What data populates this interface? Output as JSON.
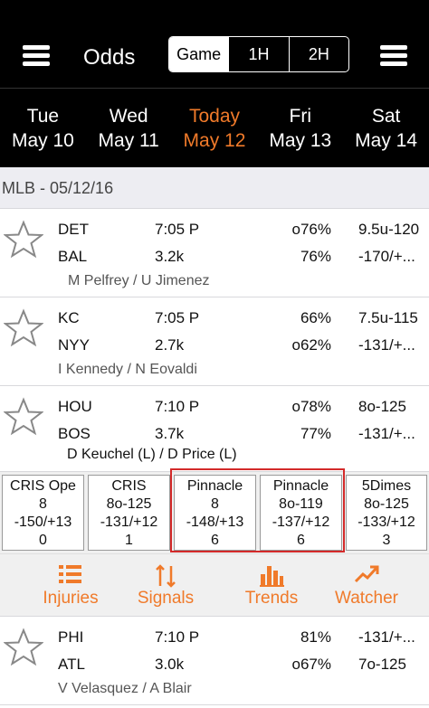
{
  "header": {
    "title": "Odds",
    "segments": [
      "Game",
      "1H",
      "2H"
    ],
    "active_segment": "Game"
  },
  "dates": [
    {
      "dow": "Tue",
      "date": "May 10"
    },
    {
      "dow": "Wed",
      "date": "May 11"
    },
    {
      "dow": "Today",
      "date": "May 12"
    },
    {
      "dow": "Fri",
      "date": "May 13"
    },
    {
      "dow": "Sat",
      "date": "May 14"
    }
  ],
  "section": {
    "title": "MLB - 05/12/16"
  },
  "games": [
    {
      "away": "DET",
      "home": "BAL",
      "time": "7:05 P",
      "count": "3.2k",
      "pct_away": "o76%",
      "pct_home": "76%",
      "line_away": "9.5u-120",
      "line_home": "-170/+...",
      "pitchers": "M Pelfrey / U Jimenez"
    },
    {
      "away": "KC",
      "home": "NYY",
      "time": "7:05 P",
      "count": "2.7k",
      "pct_away": "66%",
      "pct_home": "o62%",
      "line_away": "7.5u-115",
      "line_home": "-131/+...",
      "pitchers": "I Kennedy / N Eovaldi"
    },
    {
      "away": "HOU",
      "home": "BOS",
      "time": "7:10 P",
      "count": "3.7k",
      "pct_away": "o78%",
      "pct_home": "77%",
      "line_away": "8o-125",
      "line_home": "-131/+...",
      "pitchers": "D Keuchel (L) / D Price (L)"
    },
    {
      "away": "PHI",
      "home": "ATL",
      "time": "7:10 P",
      "count": "3.0k",
      "pct_away": "81%",
      "pct_home": "o67%",
      "line_away": "-131/+...",
      "line_home": "7o-125",
      "pitchers": "V Velasquez / A Blair"
    }
  ],
  "books": [
    {
      "name": "CRIS Ope",
      "l1": "8",
      "l2": "-150/+13",
      "l3": "0"
    },
    {
      "name": "CRIS",
      "l1": "8o-125",
      "l2": "-131/+12",
      "l3": "1"
    },
    {
      "name": "Pinnacle",
      "l1": "8",
      "l2": "-148/+13",
      "l3": "6"
    },
    {
      "name": "Pinnacle",
      "l1": "8o-119",
      "l2": "-137/+12",
      "l3": "6"
    },
    {
      "name": "5Dimes",
      "l1": "8o-125",
      "l2": "-133/+12",
      "l3": "3"
    }
  ],
  "actions": [
    {
      "label": "Injuries",
      "icon": "list-icon"
    },
    {
      "label": "Signals",
      "icon": "signals-icon"
    },
    {
      "label": "Trends",
      "icon": "bar-chart-icon"
    },
    {
      "label": "Watcher",
      "icon": "trend-arrow-icon"
    }
  ],
  "colors": {
    "accent": "#f07a2a",
    "highlight": "#d32a2a",
    "header_bg": "#000000"
  }
}
